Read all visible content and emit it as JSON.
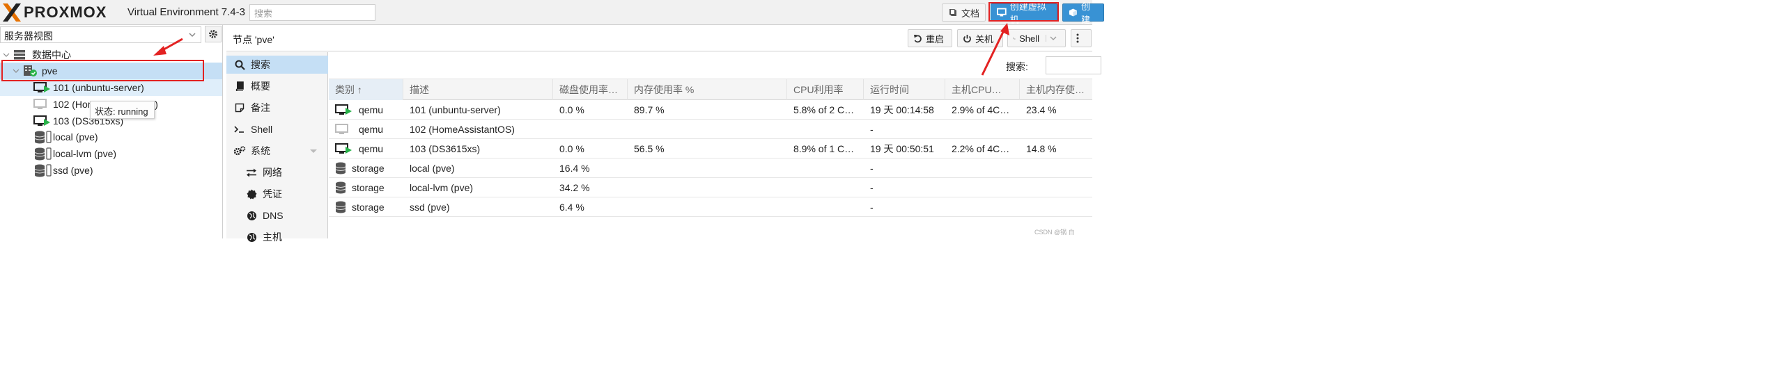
{
  "header": {
    "brand": "PROXMOX",
    "version": "Virtual Environment 7.4-3",
    "search_placeholder": "搜索",
    "docs_label": "文档",
    "create_vm_label": "创建虚拟机",
    "create_ct_label": "创建"
  },
  "sidebar": {
    "view": "服务器视图",
    "tree": [
      {
        "label": "数据中心",
        "icon": "datacenter-icon"
      },
      {
        "label": "pve",
        "icon": "node-online-icon"
      },
      {
        "label": "101 (unbuntu-server)",
        "icon": "vm-running-icon"
      },
      {
        "label": "102 (HomeAssistantOS)",
        "icon": "vm-stopped-icon"
      },
      {
        "label": "103 (DS3615xs)",
        "icon": "vm-running-icon"
      },
      {
        "label": "local (pve)",
        "icon": "storage-icon"
      },
      {
        "label": "local-lvm (pve)",
        "icon": "storage-icon"
      },
      {
        "label": "ssd (pve)",
        "icon": "storage-icon"
      }
    ],
    "tooltip": "状态: running"
  },
  "node_header": {
    "title": "节点 'pve'",
    "reboot_label": "重启",
    "shutdown_label": "关机",
    "shell_label": "Shell"
  },
  "nav": {
    "items": [
      {
        "label": "搜索",
        "icon": "search-icon"
      },
      {
        "label": "概要",
        "icon": "book-icon"
      },
      {
        "label": "备注",
        "icon": "note-icon"
      },
      {
        "label": "Shell",
        "icon": "terminal-icon"
      },
      {
        "label": "系统",
        "icon": "cogs-icon"
      },
      {
        "label": "网络",
        "icon": "exchange-icon"
      },
      {
        "label": "凭证",
        "icon": "certificate-icon"
      },
      {
        "label": "DNS",
        "icon": "globe-icon"
      },
      {
        "label": "主机",
        "icon": "globe-icon"
      }
    ]
  },
  "content": {
    "search_label": "搜索:",
    "columns": [
      "类别 ↑",
      "描述",
      "磁盘使用率…",
      "内存使用率 %",
      "CPU利用率",
      "运行时间",
      "主机CPU…",
      "主机内存使…"
    ],
    "rows": [
      {
        "type": "qemu",
        "desc": "101 (unbuntu-server)",
        "disk": "0.0 %",
        "mem": "89.7 %",
        "cpu": "5.8% of 2 C…",
        "uptime": "19 天 00:14:58",
        "hostcpu": "2.9% of 4C…",
        "hostmem": "23.4 %",
        "icon": "vm-running-icon"
      },
      {
        "type": "qemu",
        "desc": "102 (HomeAssistantOS)",
        "disk": "",
        "mem": "",
        "cpu": "",
        "uptime": "-",
        "hostcpu": "",
        "hostmem": "",
        "icon": "vm-stopped-icon"
      },
      {
        "type": "qemu",
        "desc": "103 (DS3615xs)",
        "disk": "0.0 %",
        "mem": "56.5 %",
        "cpu": "8.9% of 1 C…",
        "uptime": "19 天 00:50:51",
        "hostcpu": "2.2% of 4C…",
        "hostmem": "14.8 %",
        "icon": "vm-running-icon"
      },
      {
        "type": "storage",
        "desc": "local (pve)",
        "disk": "16.4 %",
        "mem": "",
        "cpu": "",
        "uptime": "-",
        "hostcpu": "",
        "hostmem": "",
        "icon": "storage-icon"
      },
      {
        "type": "storage",
        "desc": "local-lvm (pve)",
        "disk": "34.2 %",
        "mem": "",
        "cpu": "",
        "uptime": "-",
        "hostcpu": "",
        "hostmem": "",
        "icon": "storage-icon"
      },
      {
        "type": "storage",
        "desc": "ssd (pve)",
        "disk": "6.4 %",
        "mem": "",
        "cpu": "",
        "uptime": "-",
        "hostcpu": "",
        "hostmem": "",
        "icon": "storage-icon"
      }
    ]
  },
  "watermark": "CSDN @锅 白",
  "colors": {
    "accent": "#3892d4",
    "selection": "#c5dff5",
    "running": "#29b34a",
    "annotation": "#e32222"
  }
}
